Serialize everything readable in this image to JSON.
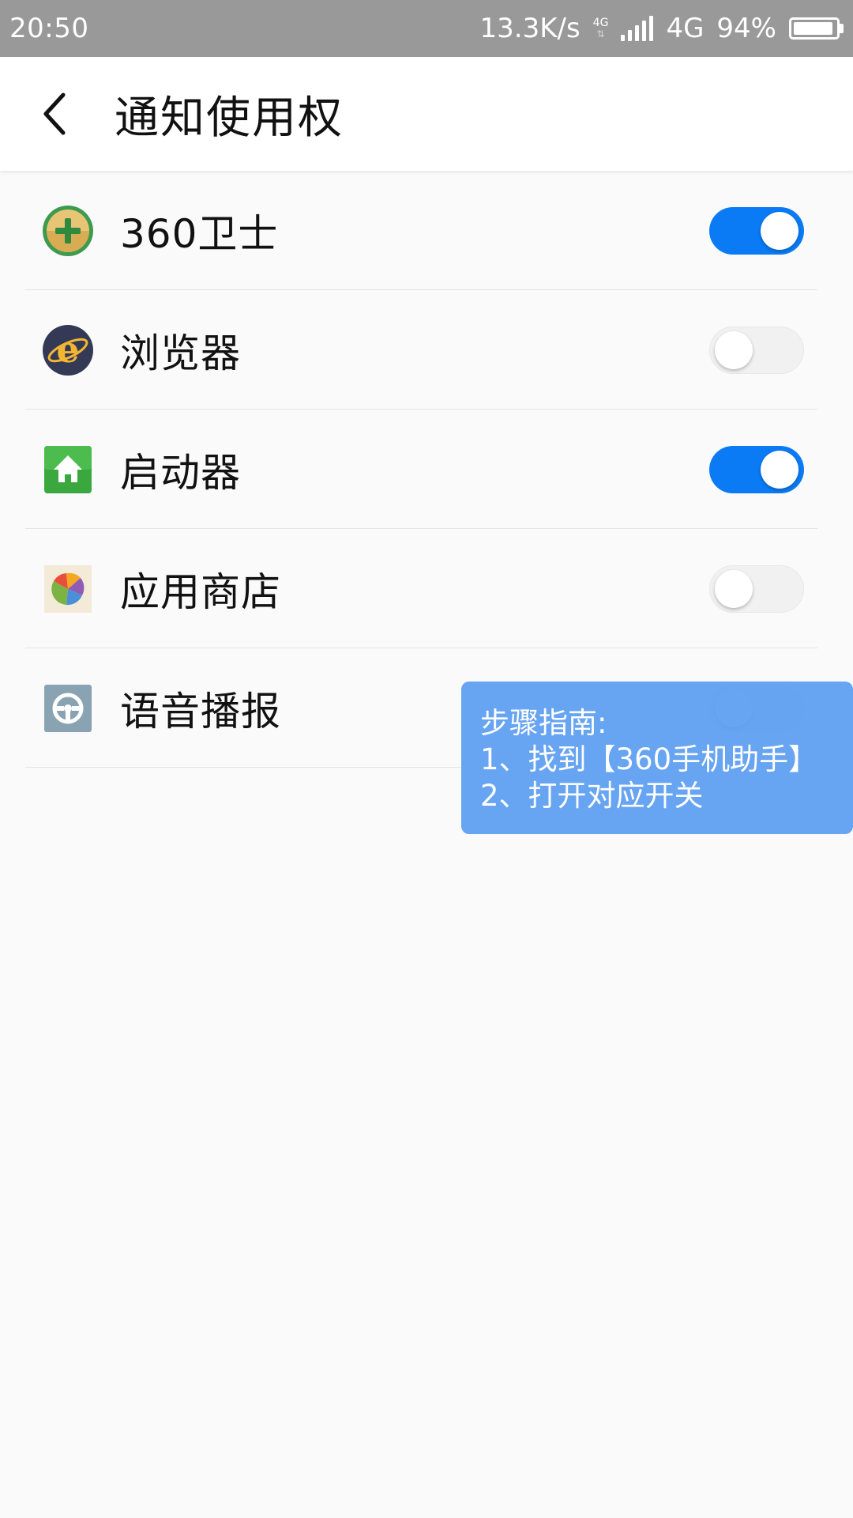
{
  "status_bar": {
    "time": "20:50",
    "net_speed": "13.3K/s",
    "data_indicator": "4G",
    "network_type": "4G",
    "battery_percent": "94%",
    "battery_level": 0.94,
    "icons": [
      "data-activity-icon",
      "signal-icon",
      "battery-icon"
    ]
  },
  "header": {
    "back_icon": "chevron-left-icon",
    "title": "通知使用权"
  },
  "apps": [
    {
      "label": "360卫士",
      "icon": "360-security-icon",
      "enabled": true
    },
    {
      "label": "浏览器",
      "icon": "browser-icon",
      "enabled": false
    },
    {
      "label": "启动器",
      "icon": "launcher-home-icon",
      "enabled": true
    },
    {
      "label": "应用商店",
      "icon": "app-store-icon",
      "enabled": false
    },
    {
      "label": "语音播报",
      "icon": "voice-broadcast-icon",
      "enabled": false
    }
  ],
  "guide": {
    "title": "步骤指南:",
    "step1": "1、找到【360手机助手】",
    "step2": "2、打开对应开关"
  },
  "colors": {
    "status_bar_bg": "#999999",
    "toggle_on": "#0a7bf5",
    "toggle_off": "#f1f1f1",
    "guide_bg": "#5a9cf0",
    "page_bg": "#fafafa"
  }
}
